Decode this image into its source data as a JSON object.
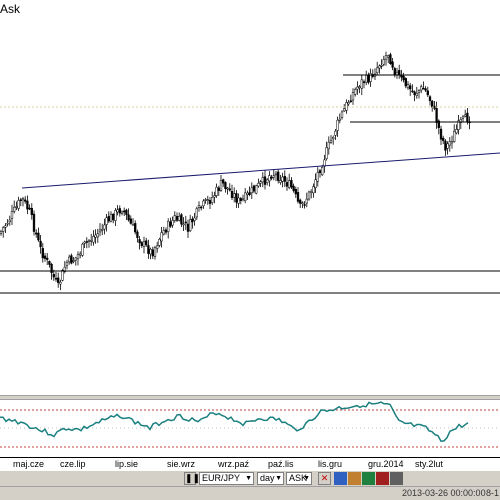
{
  "window": {
    "title": "Ask"
  },
  "chart_data": {
    "type": "candlestick",
    "price_chart": {
      "trendlines": "horizontal support/resistance lines and a rising diagonal trendline",
      "series_shape": "daily candles falling to a low near the lower support line, a long recovery along the diagonal trendline, a sharp rally to a peak, then a pullback and partial rebound"
    },
    "indicator": {
      "type": "line",
      "color": "#1a7f7f",
      "reference_levels_color": "#c04040"
    },
    "x_tick_labels": [
      "maj.cze",
      "cze.lip",
      "lip.sie",
      "sie.wrz",
      "wrz.paź",
      "paź.lis",
      "lis.gru",
      "gru.2014",
      "sty.2lut"
    ]
  },
  "toolbar": {
    "symbol": "EUR/JPY",
    "period": "day",
    "price_type": "ASK",
    "close_label": "✕"
  },
  "status": {
    "datetime": "2013-03-26 00:00:00",
    "extra": "8-1"
  },
  "colors": {
    "candle": "#000000",
    "hline": "#000000",
    "trendline": "#1a1a6e",
    "dotted_level": "#d8d0a8",
    "indicator": "#1a7f7f",
    "indicator_levels": "#c04040",
    "chrome": "#d4d0c8"
  }
}
